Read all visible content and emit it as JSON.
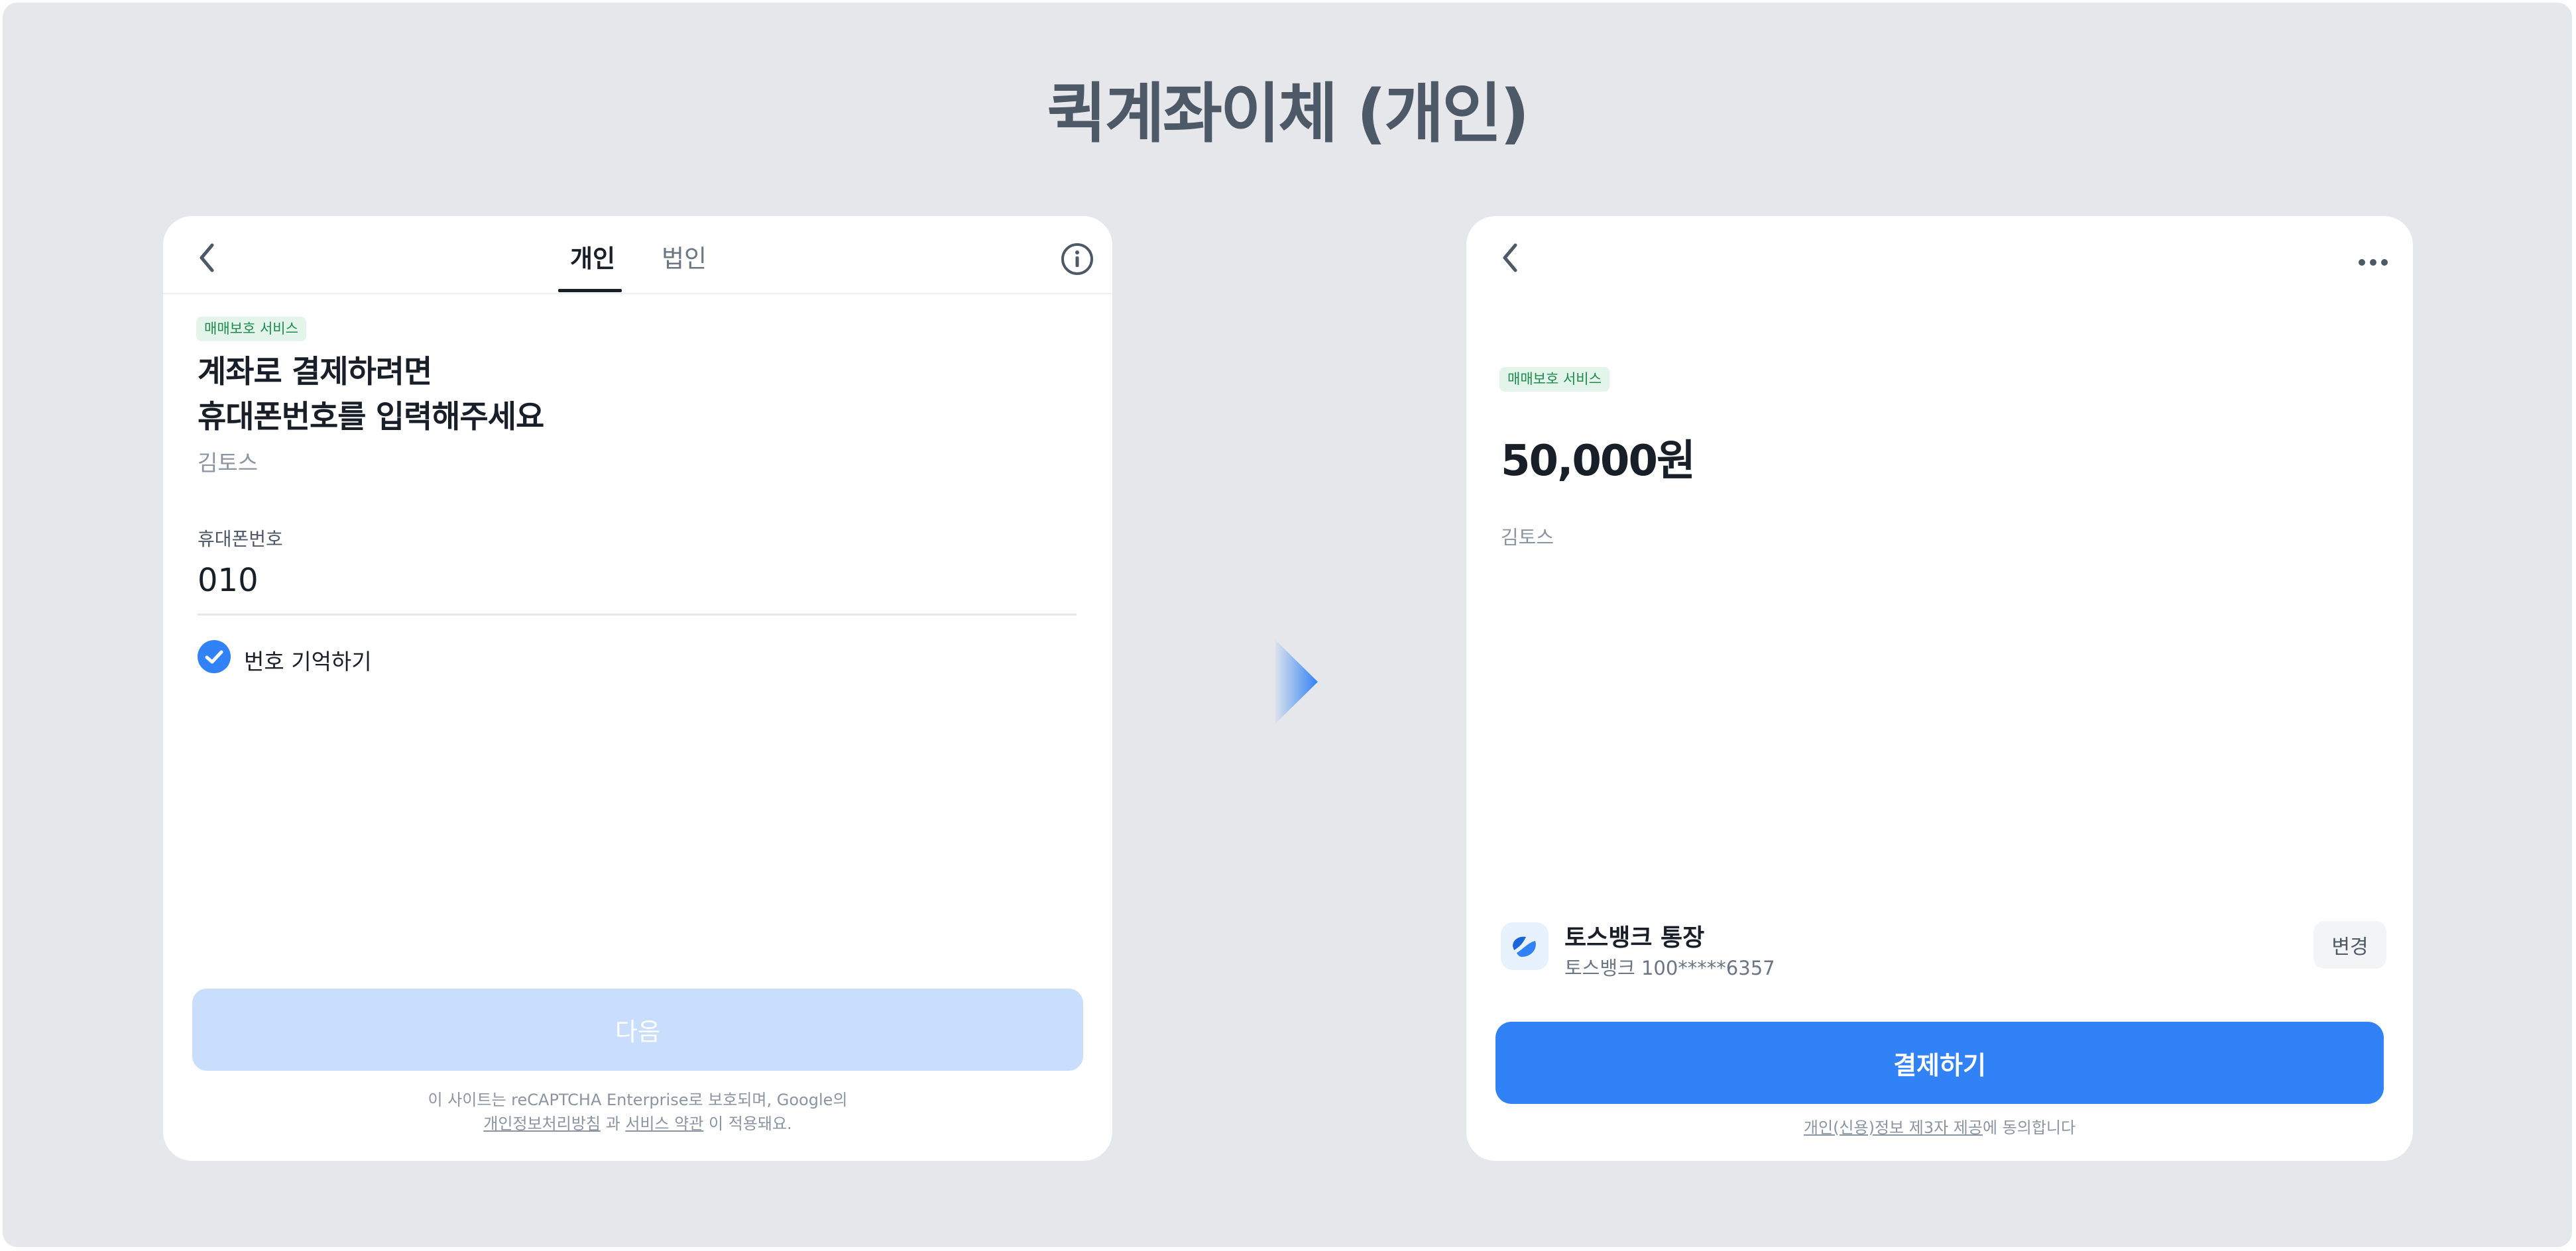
{
  "page": {
    "title": "퀵계좌이체 (개인)"
  },
  "left_screen": {
    "tabs": [
      {
        "label": "개인",
        "active": true
      },
      {
        "label": "법인",
        "active": false
      }
    ],
    "badge": "매매보호 서비스",
    "headline_line1": "계좌로 결제하려면",
    "headline_line2": "휴대폰번호를 입력해주세요",
    "merchant_name": "김토스",
    "phone_field": {
      "label": "휴대폰번호",
      "value": "010"
    },
    "remember": {
      "label": "번호 기억하기",
      "checked": true
    },
    "next_button": "다음",
    "footer": {
      "line1": "이 사이트는 reCAPTCHA Enterprise로 보호되며, Google의",
      "privacy_link": "개인정보처리방침",
      "conjunction": "과",
      "terms_link": "서비스 약관",
      "suffix": "이 적용돼요."
    }
  },
  "right_screen": {
    "badge": "매매보호 서비스",
    "amount": "50,000원",
    "merchant_name": "김토스",
    "account": {
      "bank_label": "토스뱅크 통장",
      "account_number": "토스뱅크 100*****6357",
      "change_button": "변경"
    },
    "pay_button": "결제하기",
    "consent": {
      "link": "개인(신용)정보 제3자 제공",
      "suffix": "에 동의합니다"
    }
  },
  "colors": {
    "background": "#e5e7eb",
    "primary": "#3182f6",
    "primary_disabled": "#c9ddfd",
    "badge_bg": "#e3f4ea",
    "badge_text": "#1c8a4a",
    "title": "#4e5968"
  },
  "icons": {
    "back": "chevron-left-icon",
    "info": "info-icon",
    "more": "more-horizontal-icon",
    "check": "check-circle-icon",
    "bank": "toss-bank-logo",
    "transition": "arrow-right-icon"
  }
}
